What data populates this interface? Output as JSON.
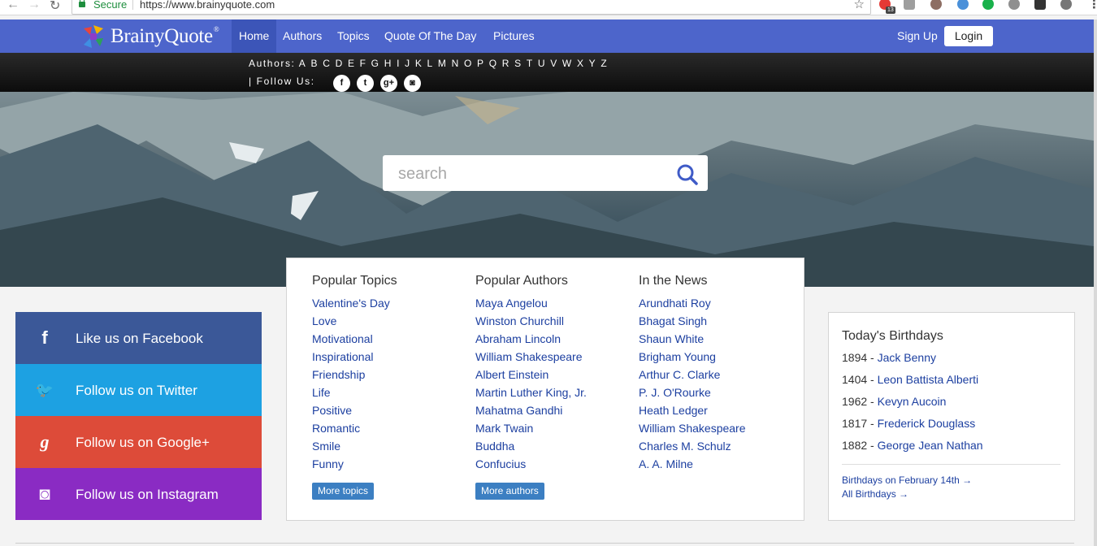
{
  "browser": {
    "secure_label": "Secure",
    "url": "https://www.brainyquote.com",
    "extension_badge": "13"
  },
  "nav": {
    "logo_text": "BrainyQuote",
    "logo_reg": "®",
    "links": [
      "Home",
      "Authors",
      "Topics",
      "Quote Of The Day",
      "Pictures"
    ],
    "active_link": "Home",
    "signup": "Sign Up",
    "login": "Login"
  },
  "subnav": {
    "authors_label": "Authors:",
    "letters": [
      "A",
      "B",
      "C",
      "D",
      "E",
      "F",
      "G",
      "H",
      "I",
      "J",
      "K",
      "L",
      "M",
      "N",
      "O",
      "P",
      "Q",
      "R",
      "S",
      "T",
      "U",
      "V",
      "W",
      "X",
      "Y",
      "Z"
    ],
    "follow_label": "|  Follow Us:",
    "social_icons": [
      "facebook-icon",
      "twitter-icon",
      "google-plus-icon",
      "instagram-icon"
    ],
    "social_glyphs": [
      "f",
      "t",
      "g+",
      "◙"
    ]
  },
  "search": {
    "placeholder": "search",
    "icon": "search-icon"
  },
  "popular": {
    "topics": {
      "heading": "Popular Topics",
      "items": [
        "Valentine's Day",
        "Love",
        "Motivational",
        "Inspirational",
        "Friendship",
        "Life",
        "Positive",
        "Romantic",
        "Smile",
        "Funny"
      ],
      "more": "More topics"
    },
    "authors": {
      "heading": "Popular Authors",
      "items": [
        "Maya Angelou",
        "Winston Churchill",
        "Abraham Lincoln",
        "William Shakespeare",
        "Albert Einstein",
        "Martin Luther King, Jr.",
        "Mahatma Gandhi",
        "Mark Twain",
        "Buddha",
        "Confucius"
      ],
      "more": "More authors"
    },
    "news": {
      "heading": "In the News",
      "items": [
        "Arundhati Roy",
        "Bhagat Singh",
        "Shaun White",
        "Brigham Young",
        "Arthur C. Clarke",
        "P. J. O'Rourke",
        "Heath Ledger",
        "William Shakespeare",
        "Charles M. Schulz",
        "A. A. Milne"
      ]
    }
  },
  "social_boxes": [
    {
      "label": "Like us on Facebook",
      "icon": "facebook-icon",
      "glyph": "f",
      "color": "#3b5898"
    },
    {
      "label": "Follow us on Twitter",
      "icon": "twitter-icon",
      "glyph": "🐦",
      "color": "#1da1e2"
    },
    {
      "label": "Follow us on Google+",
      "icon": "google-plus-icon",
      "glyph": "g",
      "color": "#dd4b39"
    },
    {
      "label": "Follow us on Instagram",
      "icon": "instagram-icon",
      "glyph": "◙",
      "color": "#8a2bc3"
    }
  ],
  "birthdays": {
    "title": "Today's Birthdays",
    "items": [
      {
        "year": "1894",
        "name": "Jack Benny"
      },
      {
        "year": "1404",
        "name": "Leon Battista Alberti"
      },
      {
        "year": "1962",
        "name": "Kevyn Aucoin"
      },
      {
        "year": "1817",
        "name": "Frederick Douglass"
      },
      {
        "year": "1882",
        "name": "George Jean Nathan"
      }
    ],
    "link_today": "Birthdays on February 14th →",
    "link_all": "All Birthdays →"
  },
  "colors": {
    "nav_blue": "#4d65cb",
    "link_blue": "#1c3fa0",
    "button_blue": "#3c7fc2"
  }
}
